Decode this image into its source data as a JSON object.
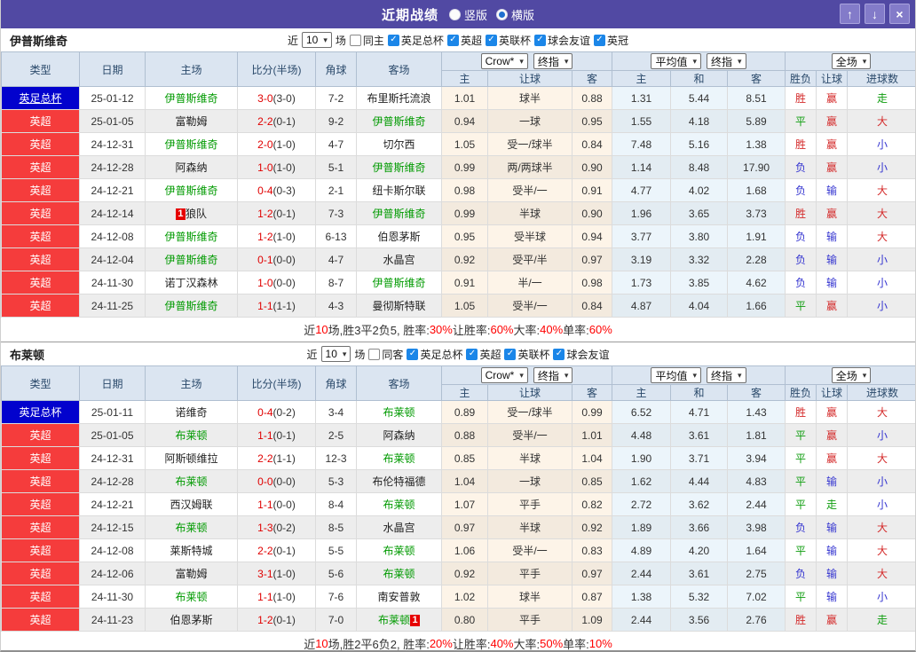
{
  "titlebar": {
    "title": "近期战绩",
    "layout_radios": [
      {
        "label": "竖版",
        "selected": false
      },
      {
        "label": "横版",
        "selected": true
      }
    ],
    "window_buttons": [
      {
        "name": "move-up",
        "glyph": "↑",
        "icon": "arrow-up-icon"
      },
      {
        "name": "move-down",
        "glyph": "↓",
        "icon": "arrow-down-icon"
      },
      {
        "name": "close",
        "glyph": "×",
        "icon": "close-icon"
      }
    ]
  },
  "icons": {
    "check": "✓",
    "caret": "▾"
  },
  "filter_labels": {
    "near": "近",
    "matches": "场"
  },
  "table_header": {
    "main_columns": [
      "类型",
      "日期",
      "主场",
      "比分(半场)",
      "角球",
      "客场"
    ],
    "odds_selects": [
      "Crow*",
      "终指"
    ],
    "odds_columns": [
      "主",
      "让球",
      "客"
    ],
    "avg_selects": [
      "平均值",
      "终指"
    ],
    "avg_columns": [
      "主",
      "和",
      "客"
    ],
    "scope_select": "全场",
    "result_columns": [
      "胜负",
      "让球",
      "进球数"
    ]
  },
  "colors": {
    "accent_purple": "#5149a3",
    "league_red": "#f53c3c",
    "cup_blue": "#0202cd",
    "focus_green": "#009a00",
    "score_red": "#e00000",
    "win_red": "#d42a2a",
    "draw_green": "#0f9d0f",
    "lose_blue": "#3434d0",
    "checkbox_blue": "#1b86e8"
  },
  "sections": [
    {
      "team": "伊普斯维奇",
      "match_count": "10",
      "same_filter": {
        "label": "同主",
        "checked": false
      },
      "league_filters": [
        {
          "label": "英足总杯",
          "checked": true
        },
        {
          "label": "英超",
          "checked": true
        },
        {
          "label": "英联杯",
          "checked": true
        },
        {
          "label": "球会友谊",
          "checked": true
        },
        {
          "label": "英冠",
          "checked": true
        }
      ],
      "rows": [
        {
          "type": "英足总杯",
          "type_bg": "blue",
          "type_underline": true,
          "date": "25-01-12",
          "home": {
            "name": "伊普斯维奇",
            "focus": true
          },
          "score": "3-0",
          "half": "(3-0)",
          "corners": "7-2",
          "away": {
            "name": "布里斯托流浪",
            "focus": false
          },
          "odds": [
            "1.01",
            "球半",
            "0.88"
          ],
          "avg": [
            "1.31",
            "5.44",
            "8.51"
          ],
          "results": [
            [
              "胜",
              "r"
            ],
            [
              "赢",
              "r"
            ],
            [
              "走",
              "g"
            ]
          ]
        },
        {
          "type": "英超",
          "type_bg": "red",
          "type_underline": false,
          "date": "25-01-05",
          "home": {
            "name": "富勒姆",
            "focus": false
          },
          "score": "2-2",
          "half": "(0-1)",
          "corners": "9-2",
          "away": {
            "name": "伊普斯维奇",
            "focus": true
          },
          "odds": [
            "0.94",
            "一球",
            "0.95"
          ],
          "avg": [
            "1.55",
            "4.18",
            "5.89"
          ],
          "results": [
            [
              "平",
              "g"
            ],
            [
              "赢",
              "r"
            ],
            [
              "大",
              "r"
            ]
          ]
        },
        {
          "type": "英超",
          "type_bg": "red",
          "type_underline": false,
          "date": "24-12-31",
          "home": {
            "name": "伊普斯维奇",
            "focus": true
          },
          "score": "2-0",
          "half": "(1-0)",
          "corners": "4-7",
          "away": {
            "name": "切尔西",
            "focus": false
          },
          "odds": [
            "1.05",
            "受一/球半",
            "0.84"
          ],
          "avg": [
            "7.48",
            "5.16",
            "1.38"
          ],
          "results": [
            [
              "胜",
              "r"
            ],
            [
              "赢",
              "r"
            ],
            [
              "小",
              "b"
            ]
          ]
        },
        {
          "type": "英超",
          "type_bg": "red",
          "type_underline": false,
          "date": "24-12-28",
          "home": {
            "name": "阿森纳",
            "focus": false
          },
          "score": "1-0",
          "half": "(1-0)",
          "corners": "5-1",
          "away": {
            "name": "伊普斯维奇",
            "focus": true
          },
          "odds": [
            "0.99",
            "两/两球半",
            "0.90"
          ],
          "avg": [
            "1.14",
            "8.48",
            "17.90"
          ],
          "results": [
            [
              "负",
              "b"
            ],
            [
              "赢",
              "r"
            ],
            [
              "小",
              "b"
            ]
          ]
        },
        {
          "type": "英超",
          "type_bg": "red",
          "type_underline": false,
          "date": "24-12-21",
          "home": {
            "name": "伊普斯维奇",
            "focus": true
          },
          "score": "0-4",
          "half": "(0-3)",
          "corners": "2-1",
          "away": {
            "name": "纽卡斯尔联",
            "focus": false
          },
          "odds": [
            "0.98",
            "受半/一",
            "0.91"
          ],
          "avg": [
            "4.77",
            "4.02",
            "1.68"
          ],
          "results": [
            [
              "负",
              "b"
            ],
            [
              "输",
              "b"
            ],
            [
              "大",
              "r"
            ]
          ]
        },
        {
          "type": "英超",
          "type_bg": "red",
          "type_underline": false,
          "date": "24-12-14",
          "home": {
            "name": "狼队",
            "focus": false,
            "badge": "1",
            "badge_pos": "left"
          },
          "score": "1-2",
          "half": "(0-1)",
          "corners": "7-3",
          "away": {
            "name": "伊普斯维奇",
            "focus": true
          },
          "odds": [
            "0.99",
            "半球",
            "0.90"
          ],
          "avg": [
            "1.96",
            "3.65",
            "3.73"
          ],
          "results": [
            [
              "胜",
              "r"
            ],
            [
              "赢",
              "r"
            ],
            [
              "大",
              "r"
            ]
          ]
        },
        {
          "type": "英超",
          "type_bg": "red",
          "type_underline": false,
          "date": "24-12-08",
          "home": {
            "name": "伊普斯维奇",
            "focus": true
          },
          "score": "1-2",
          "half": "(1-0)",
          "corners": "6-13",
          "away": {
            "name": "伯恩茅斯",
            "focus": false
          },
          "odds": [
            "0.95",
            "受半球",
            "0.94"
          ],
          "avg": [
            "3.77",
            "3.80",
            "1.91"
          ],
          "results": [
            [
              "负",
              "b"
            ],
            [
              "输",
              "b"
            ],
            [
              "大",
              "r"
            ]
          ]
        },
        {
          "type": "英超",
          "type_bg": "red",
          "type_underline": false,
          "date": "24-12-04",
          "home": {
            "name": "伊普斯维奇",
            "focus": true
          },
          "score": "0-1",
          "half": "(0-0)",
          "corners": "4-7",
          "away": {
            "name": "水晶宫",
            "focus": false
          },
          "odds": [
            "0.92",
            "受平/半",
            "0.97"
          ],
          "avg": [
            "3.19",
            "3.32",
            "2.28"
          ],
          "results": [
            [
              "负",
              "b"
            ],
            [
              "输",
              "b"
            ],
            [
              "小",
              "b"
            ]
          ]
        },
        {
          "type": "英超",
          "type_bg": "red",
          "type_underline": false,
          "date": "24-11-30",
          "home": {
            "name": "诺丁汉森林",
            "focus": false
          },
          "score": "1-0",
          "half": "(0-0)",
          "corners": "8-7",
          "away": {
            "name": "伊普斯维奇",
            "focus": true
          },
          "odds": [
            "0.91",
            "半/一",
            "0.98"
          ],
          "avg": [
            "1.73",
            "3.85",
            "4.62"
          ],
          "results": [
            [
              "负",
              "b"
            ],
            [
              "输",
              "b"
            ],
            [
              "小",
              "b"
            ]
          ]
        },
        {
          "type": "英超",
          "type_bg": "red",
          "type_underline": false,
          "date": "24-11-25",
          "home": {
            "name": "伊普斯维奇",
            "focus": true
          },
          "score": "1-1",
          "half": "(1-1)",
          "corners": "4-3",
          "away": {
            "name": "曼彻斯特联",
            "focus": false
          },
          "odds": [
            "1.05",
            "受半/一",
            "0.84"
          ],
          "avg": [
            "4.87",
            "4.04",
            "1.66"
          ],
          "results": [
            [
              "平",
              "g"
            ],
            [
              "赢",
              "r"
            ],
            [
              "小",
              "b"
            ]
          ]
        }
      ],
      "summary_segments": [
        [
          "近",
          "k"
        ],
        [
          "10",
          "r"
        ],
        [
          "场,胜3平2负5, 胜率:",
          "k"
        ],
        [
          "30%",
          "r"
        ],
        [
          " 让胜率:",
          "k"
        ],
        [
          "60%",
          "r"
        ],
        [
          " 大率:",
          "k"
        ],
        [
          "40%",
          "r"
        ],
        [
          " 单率:",
          "k"
        ],
        [
          "60%",
          "r"
        ]
      ]
    },
    {
      "team": "布莱顿",
      "match_count": "10",
      "same_filter": {
        "label": "同客",
        "checked": false
      },
      "league_filters": [
        {
          "label": "英足总杯",
          "checked": true
        },
        {
          "label": "英超",
          "checked": true
        },
        {
          "label": "英联杯",
          "checked": true
        },
        {
          "label": "球会友谊",
          "checked": true
        }
      ],
      "rows": [
        {
          "type": "英足总杯",
          "type_bg": "blue",
          "type_underline": false,
          "date": "25-01-11",
          "home": {
            "name": "诺维奇",
            "focus": false
          },
          "score": "0-4",
          "half": "(0-2)",
          "corners": "3-4",
          "away": {
            "name": "布莱顿",
            "focus": true
          },
          "odds": [
            "0.89",
            "受一/球半",
            "0.99"
          ],
          "avg": [
            "6.52",
            "4.71",
            "1.43"
          ],
          "results": [
            [
              "胜",
              "r"
            ],
            [
              "赢",
              "r"
            ],
            [
              "大",
              "r"
            ]
          ]
        },
        {
          "type": "英超",
          "type_bg": "red",
          "type_underline": false,
          "date": "25-01-05",
          "home": {
            "name": "布莱顿",
            "focus": true
          },
          "score": "1-1",
          "half": "(0-1)",
          "corners": "2-5",
          "away": {
            "name": "阿森纳",
            "focus": false
          },
          "odds": [
            "0.88",
            "受半/一",
            "1.01"
          ],
          "avg": [
            "4.48",
            "3.61",
            "1.81"
          ],
          "results": [
            [
              "平",
              "g"
            ],
            [
              "赢",
              "r"
            ],
            [
              "小",
              "b"
            ]
          ]
        },
        {
          "type": "英超",
          "type_bg": "red",
          "type_underline": false,
          "date": "24-12-31",
          "home": {
            "name": "阿斯顿维拉",
            "focus": false
          },
          "score": "2-2",
          "half": "(1-1)",
          "corners": "12-3",
          "away": {
            "name": "布莱顿",
            "focus": true
          },
          "odds": [
            "0.85",
            "半球",
            "1.04"
          ],
          "avg": [
            "1.90",
            "3.71",
            "3.94"
          ],
          "results": [
            [
              "平",
              "g"
            ],
            [
              "赢",
              "r"
            ],
            [
              "大",
              "r"
            ]
          ]
        },
        {
          "type": "英超",
          "type_bg": "red",
          "type_underline": false,
          "date": "24-12-28",
          "home": {
            "name": "布莱顿",
            "focus": true
          },
          "score": "0-0",
          "half": "(0-0)",
          "corners": "5-3",
          "away": {
            "name": "布伦特福德",
            "focus": false
          },
          "odds": [
            "1.04",
            "一球",
            "0.85"
          ],
          "avg": [
            "1.62",
            "4.44",
            "4.83"
          ],
          "results": [
            [
              "平",
              "g"
            ],
            [
              "输",
              "b"
            ],
            [
              "小",
              "b"
            ]
          ]
        },
        {
          "type": "英超",
          "type_bg": "red",
          "type_underline": false,
          "date": "24-12-21",
          "home": {
            "name": "西汉姆联",
            "focus": false
          },
          "score": "1-1",
          "half": "(0-0)",
          "corners": "8-4",
          "away": {
            "name": "布莱顿",
            "focus": true
          },
          "odds": [
            "1.07",
            "平手",
            "0.82"
          ],
          "avg": [
            "2.72",
            "3.62",
            "2.44"
          ],
          "results": [
            [
              "平",
              "g"
            ],
            [
              "走",
              "g"
            ],
            [
              "小",
              "b"
            ]
          ]
        },
        {
          "type": "英超",
          "type_bg": "red",
          "type_underline": false,
          "date": "24-12-15",
          "home": {
            "name": "布莱顿",
            "focus": true
          },
          "score": "1-3",
          "half": "(0-2)",
          "corners": "8-5",
          "away": {
            "name": "水晶宫",
            "focus": false
          },
          "odds": [
            "0.97",
            "半球",
            "0.92"
          ],
          "avg": [
            "1.89",
            "3.66",
            "3.98"
          ],
          "results": [
            [
              "负",
              "b"
            ],
            [
              "输",
              "b"
            ],
            [
              "大",
              "r"
            ]
          ]
        },
        {
          "type": "英超",
          "type_bg": "red",
          "type_underline": false,
          "date": "24-12-08",
          "home": {
            "name": "莱斯特城",
            "focus": false
          },
          "score": "2-2",
          "half": "(0-1)",
          "corners": "5-5",
          "away": {
            "name": "布莱顿",
            "focus": true
          },
          "odds": [
            "1.06",
            "受半/一",
            "0.83"
          ],
          "avg": [
            "4.89",
            "4.20",
            "1.64"
          ],
          "results": [
            [
              "平",
              "g"
            ],
            [
              "输",
              "b"
            ],
            [
              "大",
              "r"
            ]
          ]
        },
        {
          "type": "英超",
          "type_bg": "red",
          "type_underline": false,
          "date": "24-12-06",
          "home": {
            "name": "富勒姆",
            "focus": false
          },
          "score": "3-1",
          "half": "(1-0)",
          "corners": "5-6",
          "away": {
            "name": "布莱顿",
            "focus": true
          },
          "odds": [
            "0.92",
            "平手",
            "0.97"
          ],
          "avg": [
            "2.44",
            "3.61",
            "2.75"
          ],
          "results": [
            [
              "负",
              "b"
            ],
            [
              "输",
              "b"
            ],
            [
              "大",
              "r"
            ]
          ]
        },
        {
          "type": "英超",
          "type_bg": "red",
          "type_underline": false,
          "date": "24-11-30",
          "home": {
            "name": "布莱顿",
            "focus": true
          },
          "score": "1-1",
          "half": "(1-0)",
          "corners": "7-6",
          "away": {
            "name": "南安普敦",
            "focus": false
          },
          "odds": [
            "1.02",
            "球半",
            "0.87"
          ],
          "avg": [
            "1.38",
            "5.32",
            "7.02"
          ],
          "results": [
            [
              "平",
              "g"
            ],
            [
              "输",
              "b"
            ],
            [
              "小",
              "b"
            ]
          ]
        },
        {
          "type": "英超",
          "type_bg": "red",
          "type_underline": false,
          "date": "24-11-23",
          "home": {
            "name": "伯恩茅斯",
            "focus": false
          },
          "score": "1-2",
          "half": "(0-1)",
          "corners": "7-0",
          "away": {
            "name": "布莱顿",
            "focus": true,
            "badge": "1",
            "badge_pos": "right"
          },
          "odds": [
            "0.80",
            "平手",
            "1.09"
          ],
          "avg": [
            "2.44",
            "3.56",
            "2.76"
          ],
          "results": [
            [
              "胜",
              "r"
            ],
            [
              "赢",
              "r"
            ],
            [
              "走",
              "g"
            ]
          ]
        }
      ],
      "summary_segments": [
        [
          "近",
          "k"
        ],
        [
          "10",
          "r"
        ],
        [
          "场,胜2平6负2, 胜率:",
          "k"
        ],
        [
          "20%",
          "r"
        ],
        [
          " 让胜率:",
          "k"
        ],
        [
          "40%",
          "r"
        ],
        [
          " 大率:",
          "k"
        ],
        [
          "50%",
          "r"
        ],
        [
          " 单率:",
          "k"
        ],
        [
          "10%",
          "r"
        ]
      ]
    }
  ]
}
